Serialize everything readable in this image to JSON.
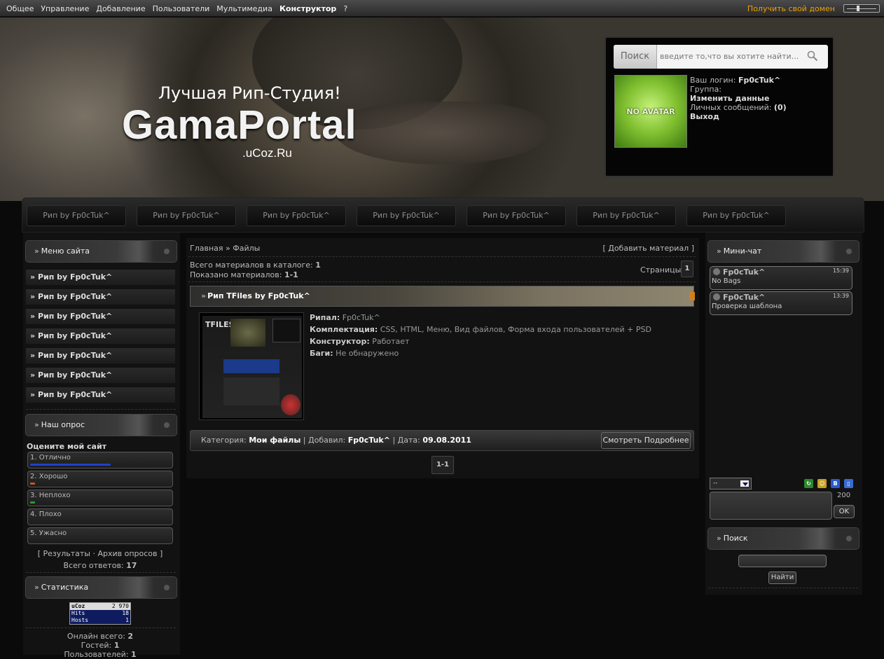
{
  "topbar": {
    "menu": [
      "Общее",
      "Управление",
      "Добавление",
      "Пользователи",
      "Мультимедиа",
      "Конструктор",
      "?"
    ],
    "domain_link": "Получить свой домен"
  },
  "header": {
    "slogan": "Лучшая Рип-Студия!",
    "logo": "GamaPortal",
    "logo_sub": ".uCoz.Ru"
  },
  "userbox": {
    "search_label": "Поиск",
    "search_placeholder": "введите то,что вы хотите найти...",
    "avatar_text": "NO AVATAR",
    "login_label": "Ваш логин:",
    "login_value": "Fp0cTuk^",
    "group_label": "Группа:",
    "edit_link": "Изменить данные",
    "pm_label": "Личных сообщений:",
    "pm_value": "(0)",
    "logout": "Выход"
  },
  "nav": [
    "Рип by Fp0cTuk^",
    "Рип by Fp0cTuk^",
    "Рип by Fp0cTuk^",
    "Рип by Fp0cTuk^",
    "Рип by Fp0cTuk^",
    "Рип by Fp0cTuk^",
    "Рип by Fp0cTuk^"
  ],
  "left": {
    "menu_title": "Меню сайта",
    "menu_items": [
      "Рип by Fp0cTuk^",
      "Рип by Fp0cTuk^",
      "Рип by Fp0cTuk^",
      "Рип by Fp0cTuk^",
      "Рип by Fp0cTuk^",
      "Рип by Fp0cTuk^",
      "Рип by Fp0cTuk^"
    ],
    "poll_title": "Наш опрос",
    "poll_question": "Оцените мой сайт",
    "poll_options": [
      {
        "label": "1. Отлично",
        "percent": 100,
        "color": "#2340c8"
      },
      {
        "label": "2. Хорошо",
        "percent": 6,
        "color": "#c8552b"
      },
      {
        "label": "3. Неплохо",
        "percent": 6,
        "color": "#2b9a2b"
      },
      {
        "label": "4. Плохо",
        "percent": 0,
        "color": "#888888"
      },
      {
        "label": "5. Ужасно",
        "percent": 0,
        "color": "#888888"
      }
    ],
    "poll_links": "[ Результаты · Архив опросов ]",
    "poll_total_label": "Всего ответов:",
    "poll_total_value": "17",
    "stats_title": "Статистика",
    "counter": {
      "name": "uCoz",
      "value": "2 970",
      "hits_label": "Hits",
      "hits": "18",
      "hosts_label": "Hosts",
      "hosts": "1"
    },
    "online_total_label": "Онлайн всего:",
    "online_total": "2",
    "guests_label": "Гостей:",
    "guests": "1",
    "users_label": "Пользователей:",
    "users": "1"
  },
  "center": {
    "breadcrumb": "Главная » Файлы",
    "add_material": "[ Добавить материал ]",
    "total_label": "Всего материалов в каталоге:",
    "total_value": "1",
    "shown_label": "Показано материалов:",
    "shown_value": "1-1",
    "pages_label": "Страницы:",
    "page_current": "1",
    "item": {
      "title": "Рип TFiles by Fp0cTuk^",
      "thumb_text": "TFILES",
      "props": [
        {
          "k": "Рипал:",
          "v": "Fp0cTuk^"
        },
        {
          "k": "Комплектация:",
          "v": "CSS, HTML, Меню, Вид файлов, Форма входа пользователей + PSD"
        },
        {
          "k": "Конструктор:",
          "v": "Работает"
        },
        {
          "k": "Баги:",
          "v": "Не обнаружено"
        }
      ],
      "category_label": "Категория:",
      "category": "Мои файлы",
      "added_label": "Добавил:",
      "added_by": "Fp0cTuk^",
      "date_label": "Дата:",
      "date": "09.08.2011",
      "more": "Смотреть Подробнее"
    },
    "pagination": "1-1"
  },
  "right": {
    "chat_title": "Мини-чат",
    "messages": [
      {
        "nick": "Fp0cTuk^",
        "time": "15:39",
        "text": "No Bags"
      },
      {
        "nick": "Fp0cTuk^",
        "time": "13:39",
        "text": "Проверка шаблона"
      }
    ],
    "chat_select": "--",
    "chat_count": "200",
    "ok": "OK",
    "search_title": "Поиск",
    "find_btn": "Найти"
  }
}
